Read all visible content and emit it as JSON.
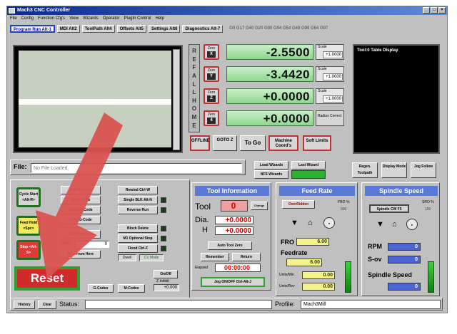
{
  "window": {
    "title": "Mach3 CNC Controller",
    "controls": [
      "_",
      "□",
      "×"
    ]
  },
  "menu": [
    "File",
    "Config",
    "Function Cfg's",
    "View",
    "Wizards",
    "Operator",
    "PlugIn Control",
    "Help"
  ],
  "tabs": [
    {
      "label": "Program Run Alt-1",
      "active": true
    },
    {
      "label": "MDI Alt2",
      "active": false
    },
    {
      "label": "ToolPath Alt4",
      "active": false
    },
    {
      "label": "Offsets Alt5",
      "active": false
    },
    {
      "label": "Settings Alt6",
      "active": false
    },
    {
      "label": "Diagnostics Alt-7",
      "active": false
    }
  ],
  "active_gcodes": "G0 G17 G40 G20 G90 G94 G54 G49 G99 G64 G97",
  "ref_all_home": [
    "R",
    "E",
    "F",
    "A",
    "L",
    "L",
    "H",
    "O",
    "M",
    "E"
  ],
  "axes": [
    {
      "zero_label": "Zero",
      "axis": "X",
      "dro": "-2.5500",
      "scale_label": "Scale",
      "scale_value": "+1.0000"
    },
    {
      "zero_label": "Zero",
      "axis": "Y",
      "dro": "-3.4420",
      "scale_label": "Scale",
      "scale_value": "+1.0000"
    },
    {
      "zero_label": "Zero",
      "axis": "Z",
      "dro": "+0.0000",
      "scale_label": "Scale",
      "scale_value": "+1.0000"
    },
    {
      "zero_label": "Zero",
      "axis": "4",
      "dro": "+0.0000",
      "scale_label": "Radius Correct",
      "scale_value": ""
    }
  ],
  "dro_controls": {
    "offline": "OFFLINE",
    "goto_z": "GOTO Z",
    "to_go": "To Go",
    "machine_coords": "Machine Coord's",
    "soft_limits": "Soft Limits"
  },
  "tool_table": {
    "title": "Tool:0   Table Display"
  },
  "file": {
    "label": "File:",
    "value": "No File Loaded."
  },
  "wizards": {
    "load": "Load Wizards",
    "last": "Last Wizard",
    "nfs": "NFS Wizards"
  },
  "right_buttons": [
    "Regen. Toolpath",
    "Display Mode",
    "Jog Follow"
  ],
  "program": {
    "cycle_start": "Cycle Start <Alt-R>",
    "feed_hold": "Feed Hold <Spc>",
    "stop": "Stop <Alt-S>",
    "reset": "Reset",
    "edit": "Edit G-Code",
    "recent": "Recent File",
    "close": "Close G-Code",
    "load": "Load G-Code",
    "set_next": "Set Next Line",
    "line_label": "Line:",
    "line_value": "0",
    "run_from_here": "Run From Here",
    "rewind": "Rewind Ctrl-W",
    "single_blk": "Single BLK Alt-N",
    "reverse_run": "Reverse Run",
    "block_delete": "Block Delete",
    "m1_stop": "M1 Optional Stop",
    "flood": "Flood Ctrl-F",
    "dwell": "Dwell",
    "cv_mode": "CV Mode",
    "on_off": "On/Off",
    "z_inhibit": "Z Inhibit",
    "z_inhibit_value": "+0.000",
    "g_codes": "G-Codes",
    "m_codes": "M-Codes"
  },
  "tool_info": {
    "title": "Tool Information",
    "tool_label": "Tool",
    "tool_value": "0",
    "change_label": "Change",
    "dia_label": "Dia.",
    "dia_value": "+0.0000",
    "h_label": "H",
    "h_value": "+0.0000",
    "auto_tool_zero": "Auto Tool Zero",
    "remember": "Remember",
    "return": "Return",
    "elapsed_label": "Elapsed",
    "elapsed_value": "00:00:00",
    "jog_onoff": "Jog ON/OFF Ctrl-Alt-J"
  },
  "feed_rate": {
    "title": "Feed Rate",
    "overridden": "OverRidden",
    "fro_pct_label": "FRO %",
    "fro_pct_value": "900",
    "fro_label": "FRO",
    "fro_value": "6.00",
    "feedrate_label": "Feedrate",
    "feedrate_value": "6.00",
    "units_min_label": "Units/Min",
    "units_min_value": "0.00",
    "units_rev_label": "Units/Rev",
    "units_rev_value": "0.00"
  },
  "spindle": {
    "title": "Spindle Speed",
    "cw": "Spindle CW F5",
    "sro_label": "SRO %",
    "sro_value": "100",
    "rpm_label": "RPM",
    "rpm_value": "0",
    "sov_label": "S-ov",
    "sov_value": "0",
    "speed_label": "Spindle Speed",
    "speed_value": "0"
  },
  "status": {
    "history": "History",
    "clear": "Clear",
    "status_label": "Status:",
    "status_value": "",
    "profile_label": "Profile:",
    "profile_value": "Mach3Mill"
  },
  "colors": {
    "dro_green": "#8fd88f",
    "accent_blue": "#5a78d8",
    "reset_red": "#d02a2a",
    "arrow_red": "#d9534f"
  }
}
